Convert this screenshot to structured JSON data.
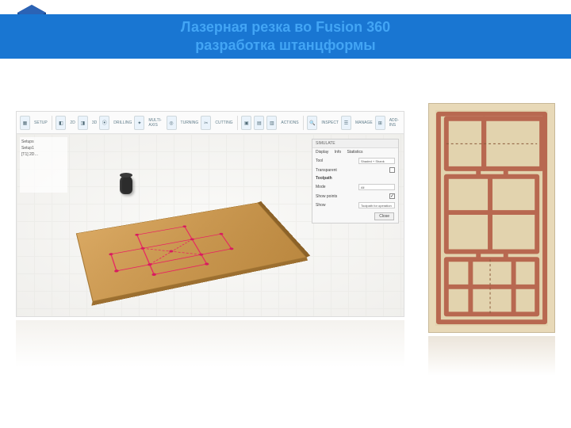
{
  "header": {
    "title_line1": "Лазерная резка во Fusion 360",
    "title_line2": "разработка штанцформы"
  },
  "fusion_toolbar": {
    "groups": [
      {
        "label": "SETUP",
        "icons": [
          "setup-icon"
        ]
      },
      {
        "label": "2D",
        "icons": [
          "2d-icon"
        ]
      },
      {
        "label": "3D",
        "icons": [
          "3d-icon"
        ]
      },
      {
        "label": "DRILLING",
        "icons": [
          "drill-icon"
        ]
      },
      {
        "label": "MULTI-AXIS",
        "icons": [
          "multiaxis-icon"
        ]
      },
      {
        "label": "TURNING",
        "icons": [
          "turn-icon"
        ]
      },
      {
        "label": "CUTTING",
        "icons": [
          "cut-icon"
        ]
      },
      {
        "label": "ACTIONS",
        "icons": [
          "act1-icon",
          "act2-icon",
          "act3-icon"
        ]
      },
      {
        "label": "INSPECT",
        "icons": [
          "inspect-icon"
        ]
      },
      {
        "label": "MANAGE",
        "icons": [
          "manage-icon"
        ]
      },
      {
        "label": "ADD-INS",
        "icons": [
          "addins-icon"
        ]
      }
    ]
  },
  "browser": {
    "root": "Setups",
    "items": [
      "Setup1",
      "[T1] 2D…"
    ]
  },
  "properties_panel": {
    "title": "SIMULATE",
    "tabs": [
      "Display",
      "Info",
      "Statistics"
    ],
    "rows": [
      {
        "label": "Tool",
        "value": "Shaded + Shank"
      },
      {
        "label": "Transparent",
        "checkbox": false
      },
      {
        "label": "Toolpath",
        "section": true
      },
      {
        "label": "Mode",
        "value": "All"
      },
      {
        "label": "Show points",
        "checkbox": true
      },
      {
        "label": "Show",
        "value": "Toolpath for operation"
      }
    ],
    "close": "Close"
  }
}
